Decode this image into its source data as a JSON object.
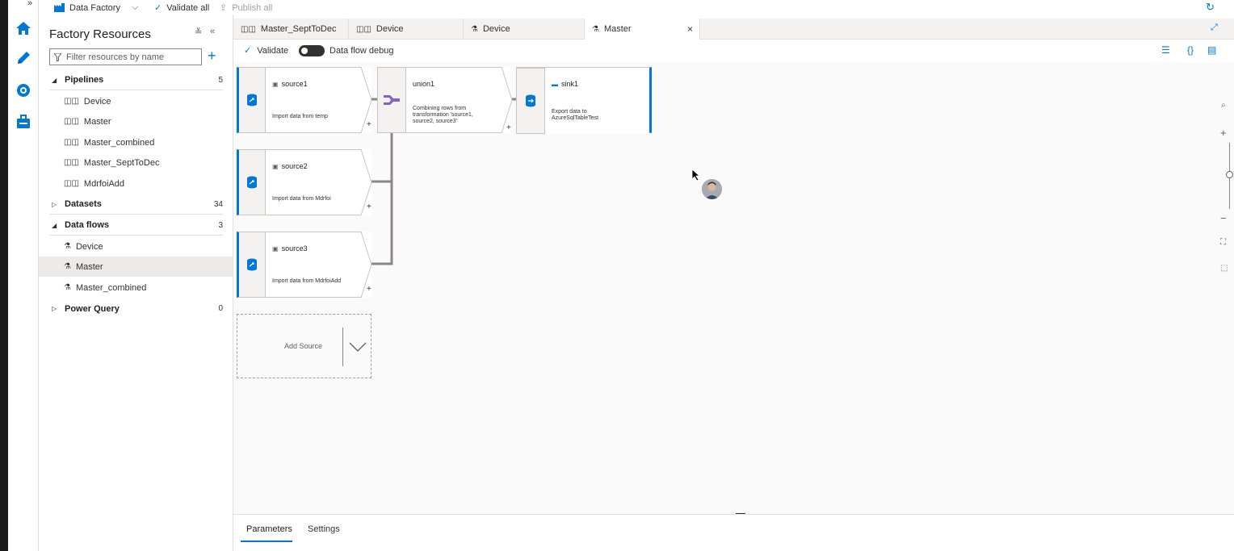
{
  "topbar": {
    "factory_label": "Data Factory",
    "validate_all_label": "Validate all",
    "publish_all_label": "Publish all"
  },
  "resources": {
    "title": "Factory Resources",
    "filter_placeholder": "Filter resources by name",
    "groups": [
      {
        "name": "Pipelines",
        "count": "5",
        "items": [
          "Device",
          "Master",
          "Master_combined",
          "Master_SeptToDec",
          "MdrfoiAdd"
        ]
      },
      {
        "name": "Datasets",
        "count": "34",
        "items": []
      },
      {
        "name": "Data flows",
        "count": "3",
        "items": [
          "Device",
          "Master",
          "Master_combined"
        ]
      },
      {
        "name": "Power Query",
        "count": "0",
        "items": []
      }
    ],
    "selected": "Data flows / Master"
  },
  "tabs": [
    {
      "label": "Master_SeptToDec",
      "icon": "pipeline-icon"
    },
    {
      "label": "Device",
      "icon": "pipeline-icon"
    },
    {
      "label": "Device",
      "icon": "dataflow-icon"
    },
    {
      "label": "Master",
      "icon": "dataflow-icon",
      "active": true
    }
  ],
  "toolbar": {
    "validate_label": "Validate",
    "debug_label": "Data flow debug",
    "debug_on": false
  },
  "flow": {
    "source1": {
      "name": "source1",
      "desc": "Import data from temp"
    },
    "source2": {
      "name": "source2",
      "desc": "Import data from Mdrfoi"
    },
    "source3": {
      "name": "source3",
      "desc": "Import data from MdrfoiAdd"
    },
    "union1": {
      "name": "union1",
      "desc_line1": "Combining rows from",
      "desc_line2": "transformation 'source1,",
      "desc_line3": "source2, source3'"
    },
    "sink1": {
      "name": "sink1",
      "desc_line1": "Export data to",
      "desc_line2": "AzureSqlTableTest"
    },
    "add_source_label": "Add Source",
    "plus": "+"
  },
  "bottom": {
    "tabs": [
      "Parameters",
      "Settings"
    ],
    "active": "Parameters"
  },
  "colors": {
    "accent": "#0078d4",
    "union_purple": "#8661c5"
  }
}
